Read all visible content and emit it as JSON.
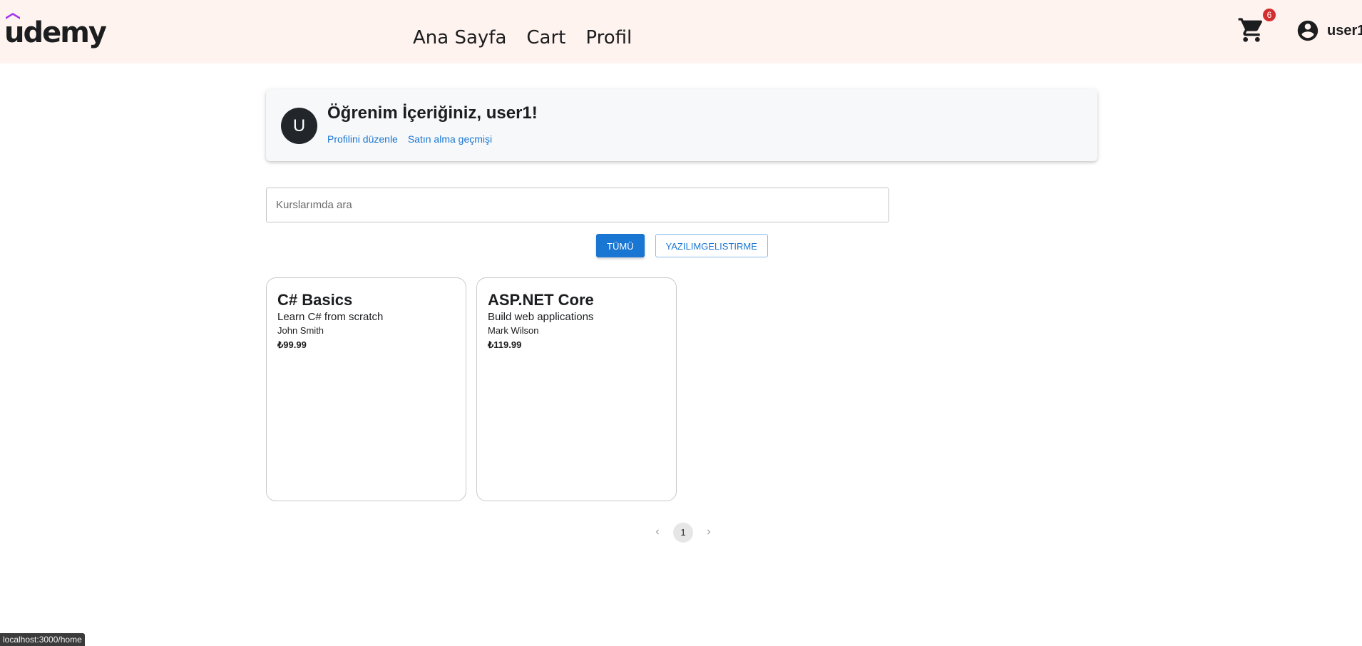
{
  "header": {
    "logo_text": "udemy",
    "nav": [
      {
        "label": "Ana Sayfa"
      },
      {
        "label": "Cart"
      },
      {
        "label": "Profil"
      }
    ],
    "cart_count": "6",
    "username": "user1"
  },
  "profile": {
    "avatar_letter": "U",
    "greeting": "Öğrenim İçeriğiniz, user1!",
    "links": [
      {
        "label": "Profilini düzenle"
      },
      {
        "label": "Satın alma geçmişi"
      }
    ]
  },
  "search": {
    "placeholder": "Kurslarımda ara",
    "value": ""
  },
  "filters": [
    {
      "label": "TÜMÜ",
      "active": true
    },
    {
      "label": "YAZILIMGELISTIRME",
      "active": false
    }
  ],
  "courses": [
    {
      "title": "C# Basics",
      "description": "Learn C# from scratch",
      "instructor": "John Smith",
      "price": "₺99.99"
    },
    {
      "title": "ASP.NET Core",
      "description": "Build web applications",
      "instructor": "Mark Wilson",
      "price": "₺119.99"
    }
  ],
  "pagination": {
    "current_page": "1",
    "prev_icon": "chevron-left-icon",
    "next_icon": "chevron-right-icon"
  },
  "status_bar": {
    "url": "localhost:3000/home"
  },
  "colors": {
    "header_bg": "#fff3ef",
    "accent": "#1976d2",
    "badge": "#d32f2f",
    "logo_hat": "#a435f0"
  }
}
